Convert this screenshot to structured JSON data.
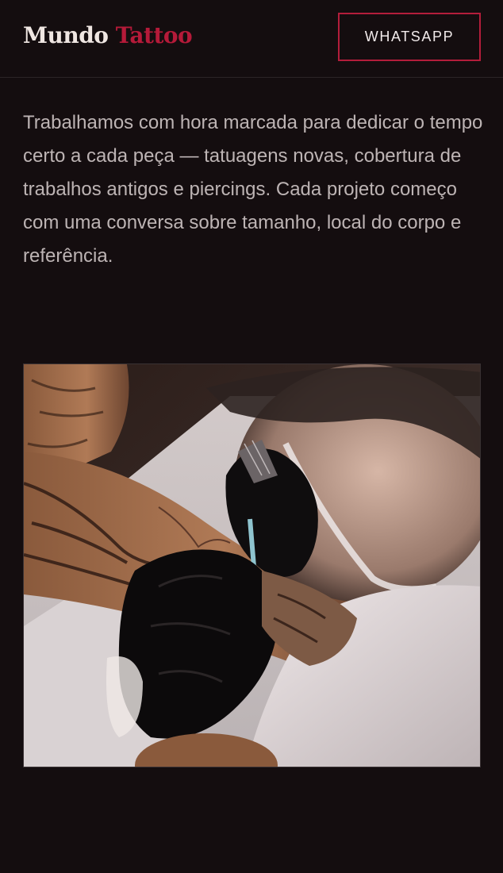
{
  "header": {
    "logo_first": "Mundo",
    "logo_second": "Tattoo",
    "whatsapp_label": "WHATSAPP"
  },
  "intro": {
    "text": "Trabalhamos com hora marcada para dedicar o tempo certo a cada peça — tatuagens novas, cobertura de trabalhos antigos e piercings. Cada projeto começo com uma conversa sobre tamanho, local do corpo e referência."
  },
  "photo": {
    "subject": "tattoo-artist-working-photo"
  },
  "colors": {
    "background": "#140d0f",
    "accent": "#b51a39",
    "text": "#bdb4b4"
  }
}
